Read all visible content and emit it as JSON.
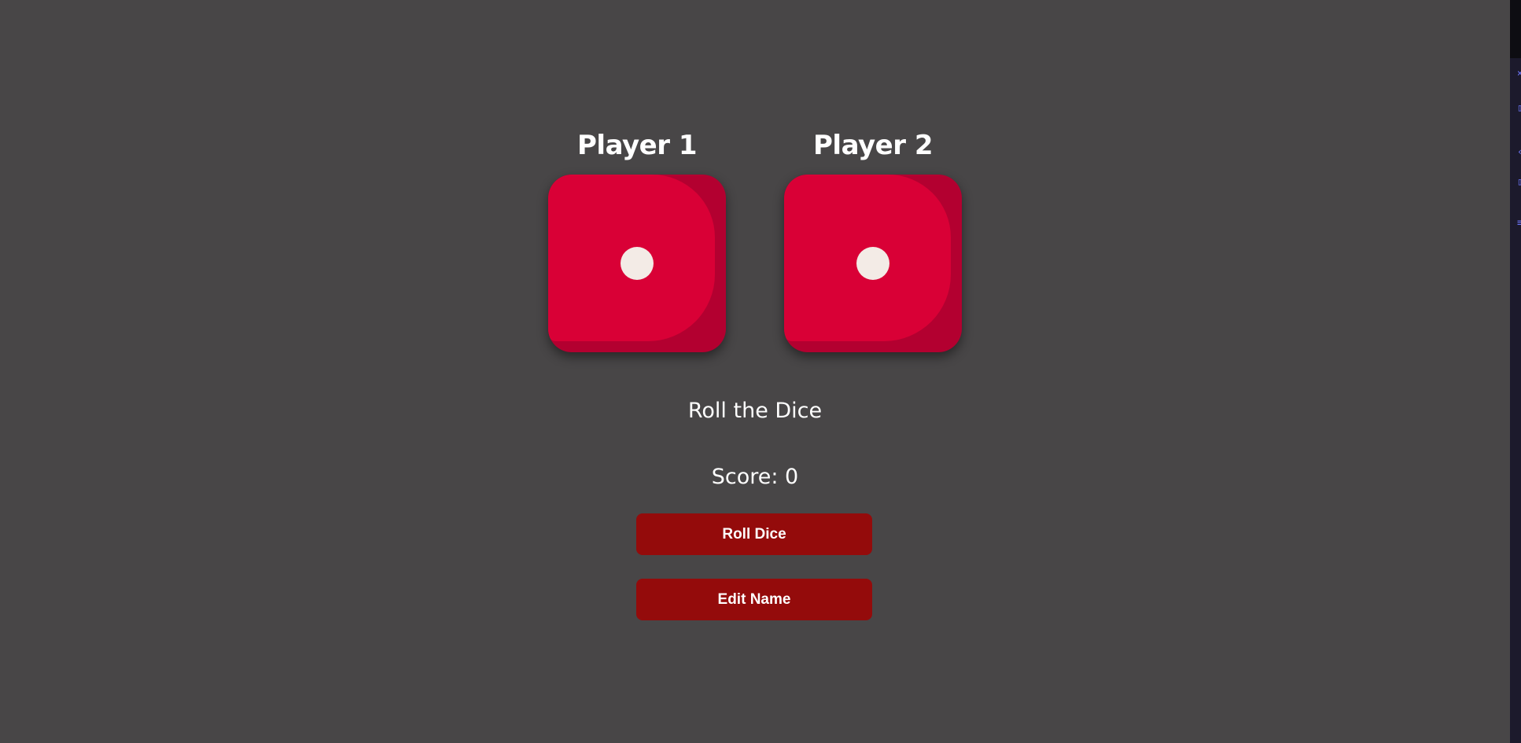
{
  "players": [
    {
      "name": "Player 1",
      "die_value": 1
    },
    {
      "name": "Player 2",
      "die_value": 1
    }
  ],
  "status": {
    "message": "Roll the Dice",
    "score_label": "Score: 0"
  },
  "buttons": {
    "roll_label": "Roll Dice",
    "edit_label": "Edit Name"
  },
  "colors": {
    "background": "#484647",
    "die_face": "#d90036",
    "die_edge": "#b30030",
    "pip": "#f3ebe6",
    "button": "#940b0b",
    "text": "#ffffff"
  },
  "icons": {
    "die": "die-one-icon",
    "pip": "pip-dot"
  }
}
